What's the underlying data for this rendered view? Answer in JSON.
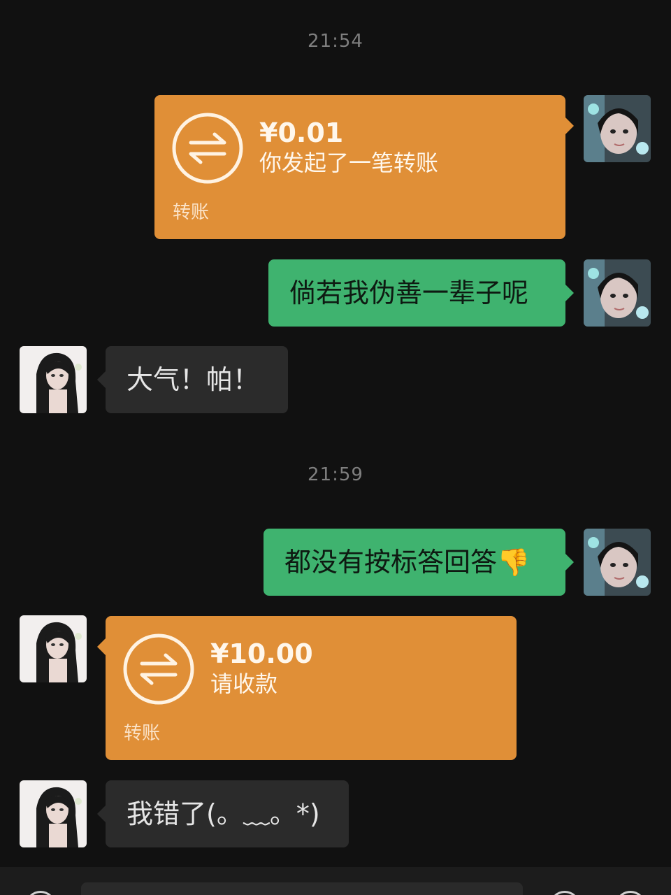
{
  "timestamps": [
    "21:54",
    "21:59"
  ],
  "colors": {
    "background": "#111111",
    "sent_bubble": "#3fb36f",
    "received_bubble": "#2b2b2b",
    "transfer_card": "#e08f37"
  },
  "messages": [
    {
      "type": "transfer",
      "direction": "sent",
      "amount": "¥0.01",
      "description": "你发起了一笔转账",
      "label": "转账",
      "icon": "transfer-arrows-icon"
    },
    {
      "type": "text",
      "direction": "sent",
      "text": "倘若我伪善一辈子呢"
    },
    {
      "type": "text",
      "direction": "received",
      "text": "大气！帕！"
    },
    {
      "type": "text",
      "direction": "sent",
      "text": "都没有按标答回答👎"
    },
    {
      "type": "transfer",
      "direction": "received",
      "amount": "¥10.00",
      "description": "请收款",
      "label": "转账",
      "icon": "transfer-arrows-icon"
    },
    {
      "type": "text",
      "direction": "received",
      "text": "我错了(。﹏。*)"
    }
  ],
  "input_bar": {
    "icons": [
      "voice-icon",
      "emoji-icon",
      "plus-icon"
    ]
  }
}
